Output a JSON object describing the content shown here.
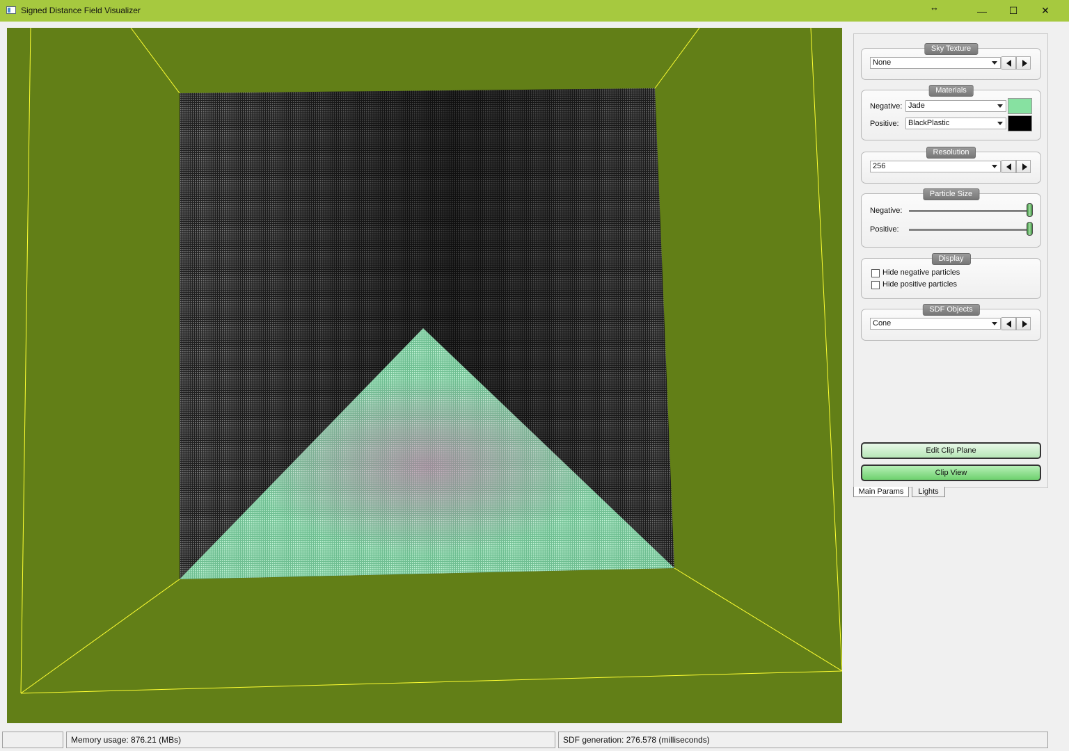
{
  "window": {
    "title": "Signed Distance Field Visualizer",
    "icons": {
      "app": "app-window-icon",
      "resize": "resize-horizontal-icon",
      "minimize": "minimize-icon",
      "maximize": "maximize-icon",
      "close": "close-icon"
    },
    "glyphs": {
      "resize": "↔",
      "minimize": "—",
      "maximize": "☐",
      "close": "✕"
    },
    "accent": "#a6c93f"
  },
  "viewport": {
    "background": "#627f17",
    "line_color": "#ffff33",
    "positive_color": "#2b2b2b",
    "negative_color": "#9ee7b7"
  },
  "panel": {
    "sky_texture": {
      "title": "Sky Texture",
      "value": "None"
    },
    "materials": {
      "title": "Materials",
      "negative_label": "Negative:",
      "negative_value": "Jade",
      "negative_color": "#87e1a1",
      "positive_label": "Positive:",
      "positive_value": "BlackPlastic",
      "positive_color": "#000000"
    },
    "resolution": {
      "title": "Resolution",
      "value": "256"
    },
    "particle_size": {
      "title": "Particle Size",
      "negative_label": "Negative:",
      "positive_label": "Positive:",
      "negative_level": 1.0,
      "positive_level": 1.0
    },
    "display": {
      "title": "Display",
      "hide_negative": "Hide negative particles",
      "hide_positive": "Hide positive particles"
    },
    "sdf_objects": {
      "title": "SDF Objects",
      "value": "Cone"
    },
    "edit_clip_plane": "Edit Clip Plane",
    "clip_view": "Clip View"
  },
  "tabs": [
    {
      "label": "Main Params",
      "active": true
    },
    {
      "label": "Lights",
      "active": false
    }
  ],
  "status": {
    "memory": "Memory usage: 876.21 (MBs)",
    "sdf_generation": "SDF generation: 276.578 (milliseconds)"
  }
}
